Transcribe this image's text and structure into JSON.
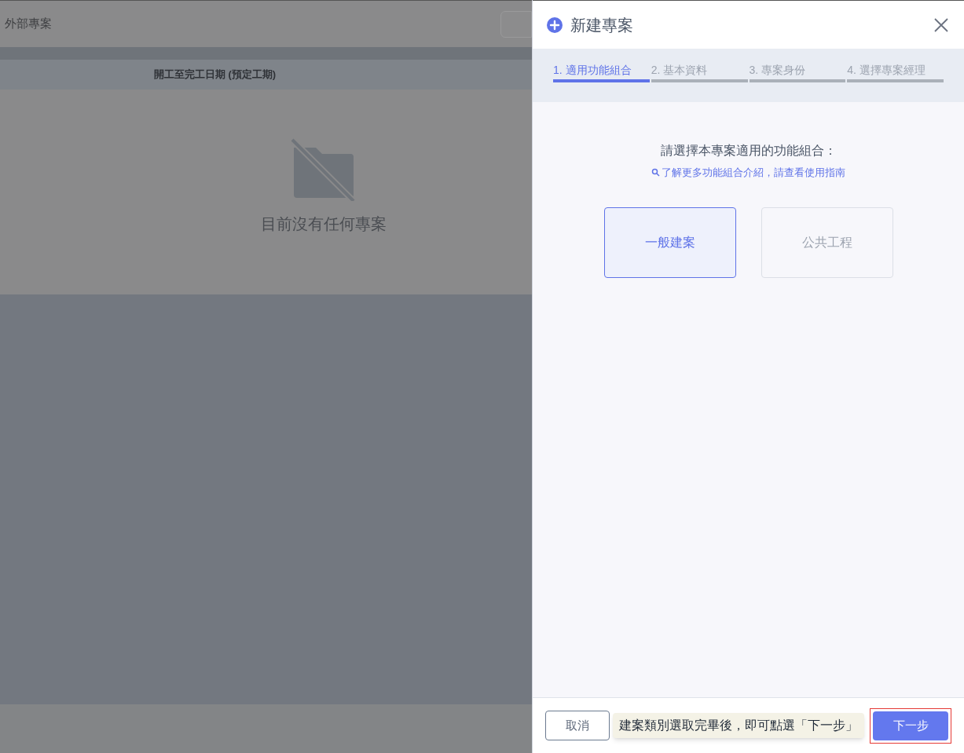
{
  "background_page": {
    "title": "外部專案",
    "table_header": "開工至完工日期 (預定工期)",
    "empty_message": "目前沒有任何專案"
  },
  "drawer": {
    "title": "新建專案",
    "steps": [
      {
        "label": "1. 適用功能組合",
        "selected": true
      },
      {
        "label": "2. 基本資料",
        "selected": false
      },
      {
        "label": "3. 專案身份",
        "selected": false
      },
      {
        "label": "4. 選擇專案經理",
        "selected": false
      }
    ],
    "prompt": "請選擇本專案適用的功能組合：",
    "guide_link": "了解更多功能組合介紹，請查看使用指南",
    "options": [
      {
        "label": "一般建案",
        "selected": true
      },
      {
        "label": "公共工程",
        "selected": false
      }
    ],
    "cancel_button": "取消",
    "tooltip": "建案類別選取完畢後，即可點選「下一步」",
    "next_button": "下一步"
  }
}
